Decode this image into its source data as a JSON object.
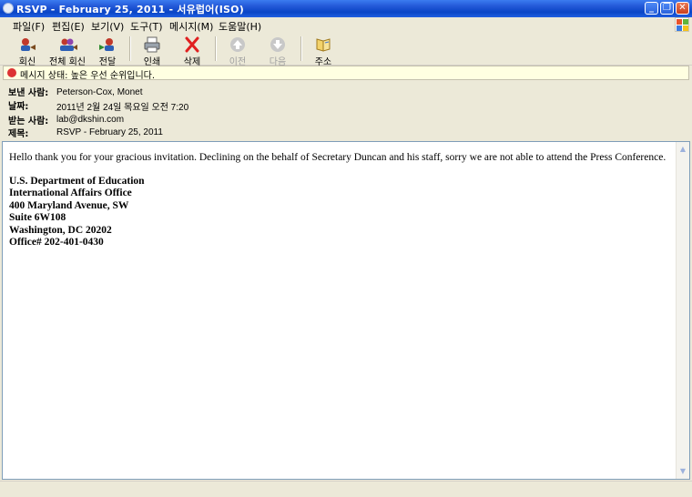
{
  "window": {
    "title": "RSVP - February 25, 2011 - 서유럽어(ISO)"
  },
  "menu": [
    "파일(F)",
    "편집(E)",
    "보기(V)",
    "도구(T)",
    "메시지(M)",
    "도움말(H)"
  ],
  "toolbar": {
    "reply": "회신",
    "reply_all": "전체 회신",
    "forward": "전달",
    "print": "인쇄",
    "delete": "삭제",
    "previous": "이전",
    "next": "다음",
    "addresses": "주소"
  },
  "infobar": {
    "text": "메시지 상태: 높은 우선 순위입니다."
  },
  "header": {
    "from_label": "보낸 사람:",
    "from": "Peterson-Cox, Monet",
    "date_label": "날짜:",
    "date": "2011년 2월 24일 목요일 오전 7:20",
    "to_label": "받는 사람:",
    "to": "lab@dkshin.com",
    "subject_label": "제목:",
    "subject": "RSVP - February 25, 2011"
  },
  "message": {
    "greeting": "Hello thank you for your gracious invitation.  Declining on the behalf of Secretary Duncan and his staff, sorry we are not able to attend the Press Conference.",
    "signature": [
      "U.S. Department of Education",
      "International Affairs Office",
      "400 Maryland Avenue, SW",
      "Suite 6W108",
      "Washington, DC  20202",
      "Office# 202-401-0430"
    ]
  },
  "colors": {
    "titlebar": "#0a45c6",
    "infobar": "#ffffe1",
    "priority": "#dd3333"
  }
}
